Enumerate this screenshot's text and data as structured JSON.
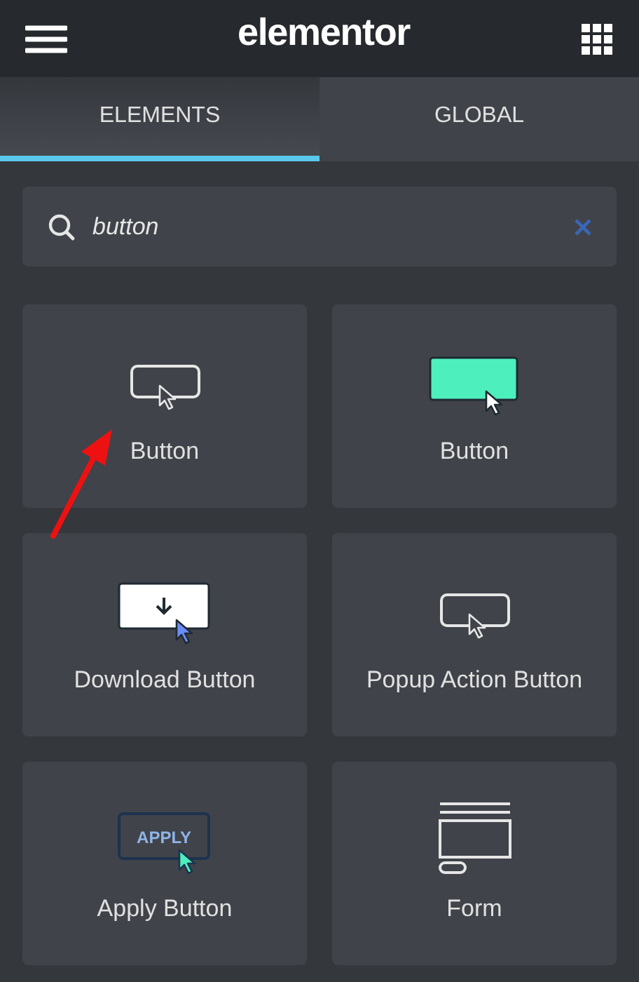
{
  "header": {
    "logo": "elementor"
  },
  "tabs": [
    {
      "label": "ELEMENTS",
      "selected": true
    },
    {
      "label": "GLOBAL",
      "selected": false
    }
  ],
  "search": {
    "value": "button"
  },
  "widgets": [
    {
      "label": "Button",
      "kind": "outline"
    },
    {
      "label": "Button",
      "kind": "filled"
    },
    {
      "label": "Download Button",
      "kind": "download"
    },
    {
      "label": "Popup Action Button",
      "kind": "outline"
    },
    {
      "label": "Apply Button",
      "kind": "apply",
      "icon_text": "APPLY"
    },
    {
      "label": "Form",
      "kind": "form"
    }
  ]
}
